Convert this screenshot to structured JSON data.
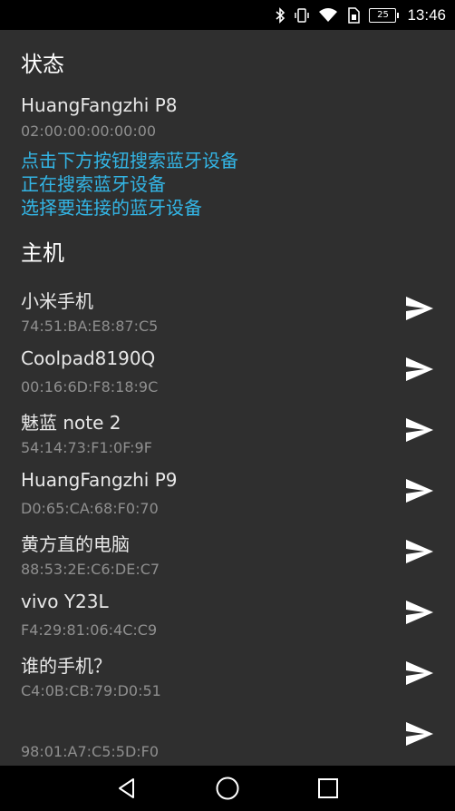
{
  "status_bar": {
    "battery": "25",
    "time": "13:46",
    "icons": [
      "bluetooth-icon",
      "vibrate-icon",
      "wifi-icon",
      "sim-icon",
      "battery-icon"
    ]
  },
  "status_section": {
    "title": "状态",
    "device_name": "HuangFangzhi P8",
    "device_address": "02:00:00:00:00:00",
    "hints": [
      "点击下方按钮搜索蓝牙设备",
      "正在搜索蓝牙设备",
      "选择要连接的蓝牙设备"
    ]
  },
  "host_section": {
    "title": "主机",
    "devices": [
      {
        "name": "小米手机",
        "address": "74:51:BA:E8:87:C5"
      },
      {
        "name": "Coolpad8190Q",
        "address": "00:16:6D:F8:18:9C"
      },
      {
        "name": "魅蓝 note 2",
        "address": "54:14:73:F1:0F:9F"
      },
      {
        "name": "HuangFangzhi P9",
        "address": "D0:65:CA:68:F0:70"
      },
      {
        "name": "黄方直的电脑",
        "address": "88:53:2E:C6:DE:C7"
      },
      {
        "name": "vivo Y23L",
        "address": "F4:29:81:06:4C:C9"
      },
      {
        "name": "谁的手机？",
        "address": "C4:0B:CB:79:D0:51"
      },
      {
        "name": "",
        "address": "98:01:A7:C5:5D:F0"
      }
    ]
  },
  "colors": {
    "background": "#2f2f2f",
    "accent": "#33b5e5",
    "secondary_text": "#8f8f8f"
  }
}
